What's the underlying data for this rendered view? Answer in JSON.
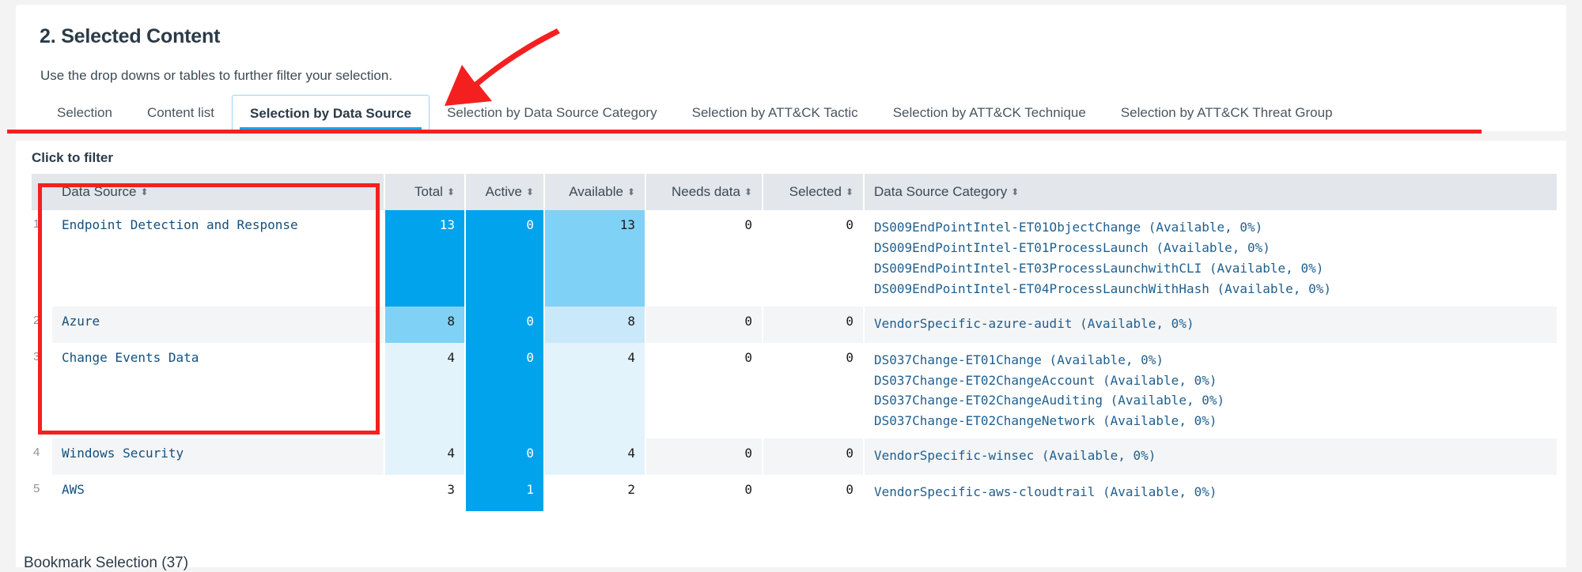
{
  "header": {
    "title": "2. Selected Content",
    "subtitle": "Use the drop downs or tables to further filter your selection."
  },
  "tabs": [
    {
      "label": "Selection",
      "active": false
    },
    {
      "label": "Content list",
      "active": false
    },
    {
      "label": "Selection by Data Source",
      "active": true
    },
    {
      "label": "Selection by Data Source Category",
      "active": false
    },
    {
      "label": "Selection by ATT&CK Tactic",
      "active": false
    },
    {
      "label": "Selection by ATT&CK Technique",
      "active": false
    },
    {
      "label": "Selection by ATT&CK Threat Group",
      "active": false
    }
  ],
  "panel": {
    "click_to_filter": "Click to filter",
    "footer_label": "Bookmark Selection (37)"
  },
  "table": {
    "columns": [
      {
        "label": "Data Source",
        "align": "left",
        "sortable": true
      },
      {
        "label": "Total",
        "align": "right",
        "sortable": true
      },
      {
        "label": "Active",
        "align": "right",
        "sortable": true
      },
      {
        "label": "Available",
        "align": "right",
        "sortable": true
      },
      {
        "label": "Needs data",
        "align": "right",
        "sortable": true
      },
      {
        "label": "Selected",
        "align": "right",
        "sortable": true
      },
      {
        "label": "Data Source Category",
        "align": "left",
        "sortable": true
      }
    ],
    "sort_icon": "sort-arrows-icon",
    "rows": [
      {
        "index": "1",
        "data_source": "Endpoint Detection and Response",
        "total": "13",
        "active": "0",
        "available": "13",
        "needs_data": "0",
        "selected": "0",
        "categories": [
          "DS009EndPointIntel-ET01ObjectChange (Available, 0%)",
          "DS009EndPointIntel-ET01ProcessLaunch (Available, 0%)",
          "DS009EndPointIntel-ET03ProcessLaunchwithCLI (Available, 0%)",
          "DS009EndPointIntel-ET04ProcessLaunchWithHash (Available, 0%)"
        ]
      },
      {
        "index": "2",
        "data_source": "Azure",
        "total": "8",
        "active": "0",
        "available": "8",
        "needs_data": "0",
        "selected": "0",
        "categories": [
          "VendorSpecific-azure-audit (Available, 0%)"
        ]
      },
      {
        "index": "3",
        "data_source": "Change Events Data",
        "total": "4",
        "active": "0",
        "available": "4",
        "needs_data": "0",
        "selected": "0",
        "categories": [
          "DS037Change-ET01Change (Available, 0%)",
          "DS037Change-ET02ChangeAccount (Available, 0%)",
          "DS037Change-ET02ChangeAuditing (Available, 0%)",
          "DS037Change-ET02ChangeNetwork (Available, 0%)"
        ]
      },
      {
        "index": "4",
        "data_source": "Windows Security",
        "total": "4",
        "active": "0",
        "available": "4",
        "needs_data": "0",
        "selected": "0",
        "categories": [
          "VendorSpecific-winsec (Available, 0%)"
        ]
      },
      {
        "index": "5",
        "data_source": "AWS",
        "total": "3",
        "active": "1",
        "available": "2",
        "needs_data": "0",
        "selected": "0",
        "categories": [
          "VendorSpecific-aws-cloudtrail (Available, 0%)"
        ]
      }
    ]
  },
  "annotations": {
    "arrow_color": "#f42020",
    "highlight_box_color": "#f42020",
    "underline_color": "#f42020"
  },
  "colors": {
    "accent_blue": "#1aa3e8",
    "heat_dark": "#00a3ec",
    "heat_mid": "#7fd1f5",
    "heat_light": "#c9e9fa",
    "heat_pale": "#e3f3fc",
    "header_bg": "#e3e6ea",
    "link_text": "#13507f"
  }
}
